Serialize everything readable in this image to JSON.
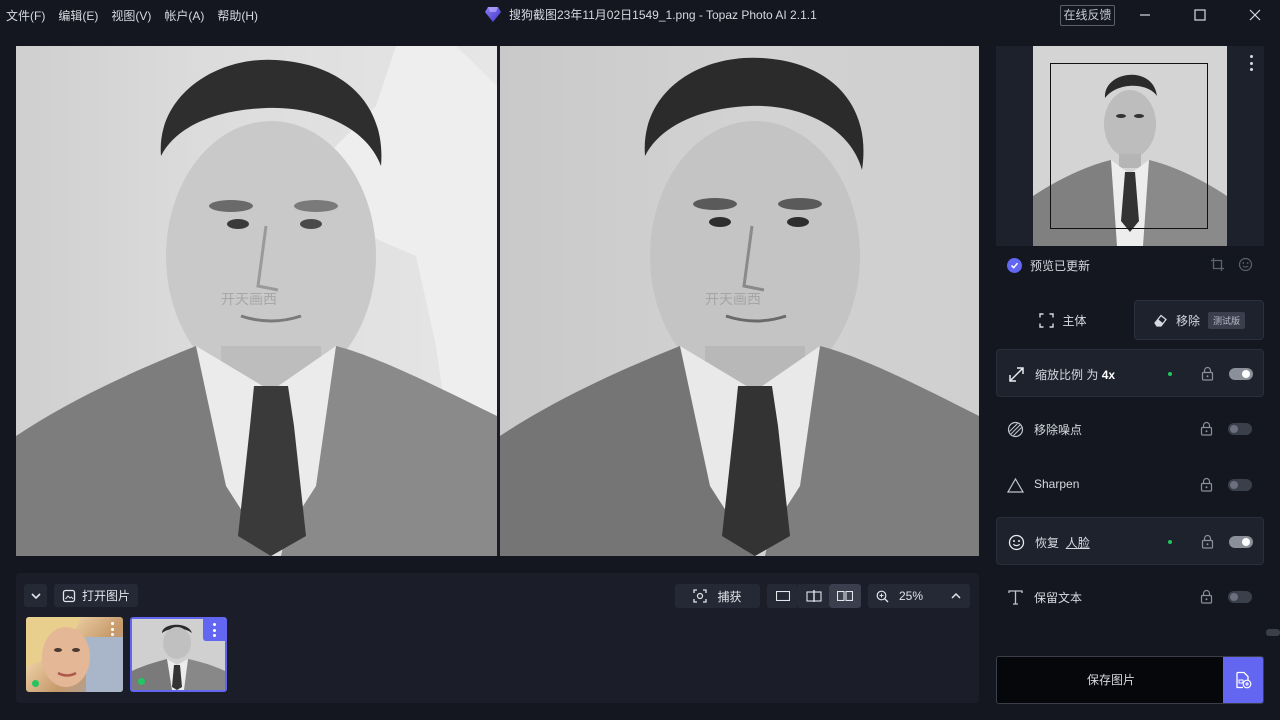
{
  "menu": [
    "文件(F)",
    "编辑(E)",
    "视图(V)",
    "帐户(A)",
    "帮助(H)"
  ],
  "window": {
    "title": "搜狗截图23年11月02日1549_1.png - Topaz Photo AI 2.1.1",
    "feedback_label": "在线反馈"
  },
  "viewer": {
    "watermark": "开天画西"
  },
  "filmstrip": {
    "open_label": "打开图片",
    "capture_label": "捕获",
    "zoom": "25%"
  },
  "panel": {
    "status_text": "预览已更新",
    "tab_subject": "主体",
    "tab_remove": "移除",
    "beta_badge": "测试版",
    "upscale_label": "缩放比例 为",
    "upscale_value": "4x",
    "denoise_label": "移除噪点",
    "sharpen_label": "Sharpen",
    "recover_label": "恢复",
    "recover_target": "人脸",
    "preserve_text_label": "保留文本",
    "save_label": "保存图片"
  },
  "colors": {
    "accent": "#6366f1",
    "enabled_dot": "#22c55e",
    "background": "#141720"
  }
}
